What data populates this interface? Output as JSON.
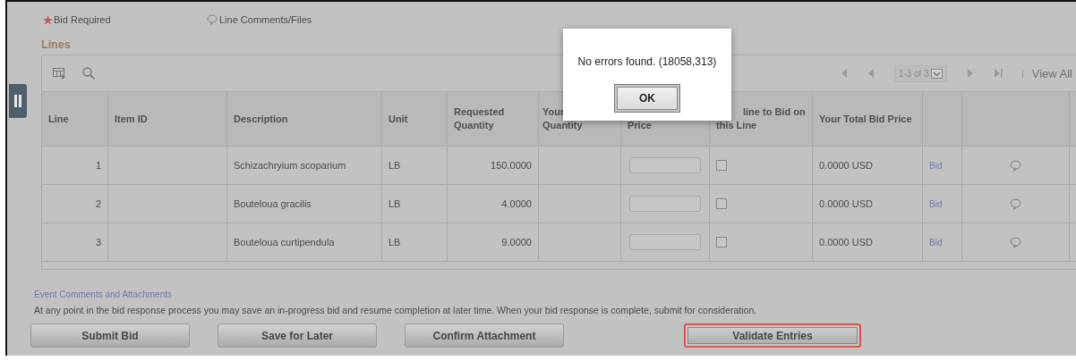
{
  "legend": {
    "required": "Bid Required",
    "comments": "Line Comments/Files"
  },
  "section_title": "Lines",
  "pager": {
    "range": "1-3 of 3",
    "view_all": "View All"
  },
  "table": {
    "columns": [
      {
        "lines": [
          "Line"
        ]
      },
      {
        "lines": [
          "Item ID"
        ]
      },
      {
        "lines": [
          "Description"
        ]
      },
      {
        "lines": [
          "Unit"
        ]
      },
      {
        "lines": [
          "Requested",
          "Quantity"
        ]
      },
      {
        "lines": [
          "Your",
          "Quantity"
        ]
      },
      {
        "lines": [
          "Price"
        ]
      },
      {
        "lines": [
          "line to Bid on",
          "this Line"
        ]
      },
      {
        "lines": [
          "Your Total Bid Price"
        ]
      }
    ],
    "rows": [
      {
        "line": "1",
        "description": "Schizachryium scoparium",
        "unit": "LB",
        "requested": "150.0000",
        "selected": false,
        "total": "0.0000 USD",
        "bid": "Bid"
      },
      {
        "line": "2",
        "description": "Bouteloua gracilis",
        "unit": "LB",
        "requested": "4.0000",
        "selected": false,
        "total": "0.0000 USD",
        "bid": "Bid"
      },
      {
        "line": "3",
        "description": "Bouteloua curtipendula",
        "unit": "LB",
        "requested": "9.0000",
        "selected": false,
        "total": "0.0000 USD",
        "bid": "Bid"
      }
    ]
  },
  "event_link": "Event Comments and Attachments",
  "instructions": "At any point in the bid response process you may save an in-progress bid and resume completion at later time. When your bid response is complete, submit for consideration.",
  "buttons": [
    {
      "label": "Submit Bid",
      "highlighted": false
    },
    {
      "label": "Save for Later",
      "highlighted": false
    },
    {
      "label": "Confirm Attachment",
      "highlighted": false
    },
    {
      "label": "Validate Entries",
      "highlighted": true
    }
  ],
  "dialog": {
    "message": "No errors found. (18058,313)",
    "button": {
      "label": "OK",
      "highlighted": true
    }
  }
}
